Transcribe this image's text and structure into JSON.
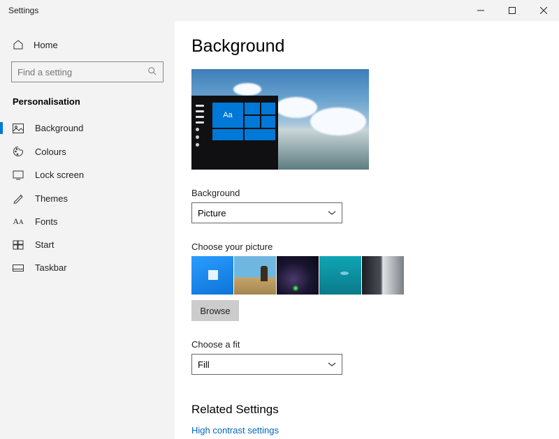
{
  "window": {
    "title": "Settings"
  },
  "sidebar": {
    "home_label": "Home",
    "search_placeholder": "Find a setting",
    "section": "Personalisation",
    "items": [
      {
        "label": "Background",
        "icon": "picture-icon",
        "active": true
      },
      {
        "label": "Colours",
        "icon": "palette-icon"
      },
      {
        "label": "Lock screen",
        "icon": "lock-screen-icon"
      },
      {
        "label": "Themes",
        "icon": "themes-icon"
      },
      {
        "label": "Fonts",
        "icon": "fonts-icon"
      },
      {
        "label": "Start",
        "icon": "start-icon"
      },
      {
        "label": "Taskbar",
        "icon": "taskbar-icon"
      }
    ]
  },
  "main": {
    "title": "Background",
    "preview_tile_text": "Aa",
    "bg_label": "Background",
    "bg_value": "Picture",
    "choose_picture_label": "Choose your picture",
    "browse_label": "Browse",
    "fit_label": "Choose a fit",
    "fit_value": "Fill",
    "related_title": "Related Settings",
    "related_link": "High contrast settings"
  }
}
